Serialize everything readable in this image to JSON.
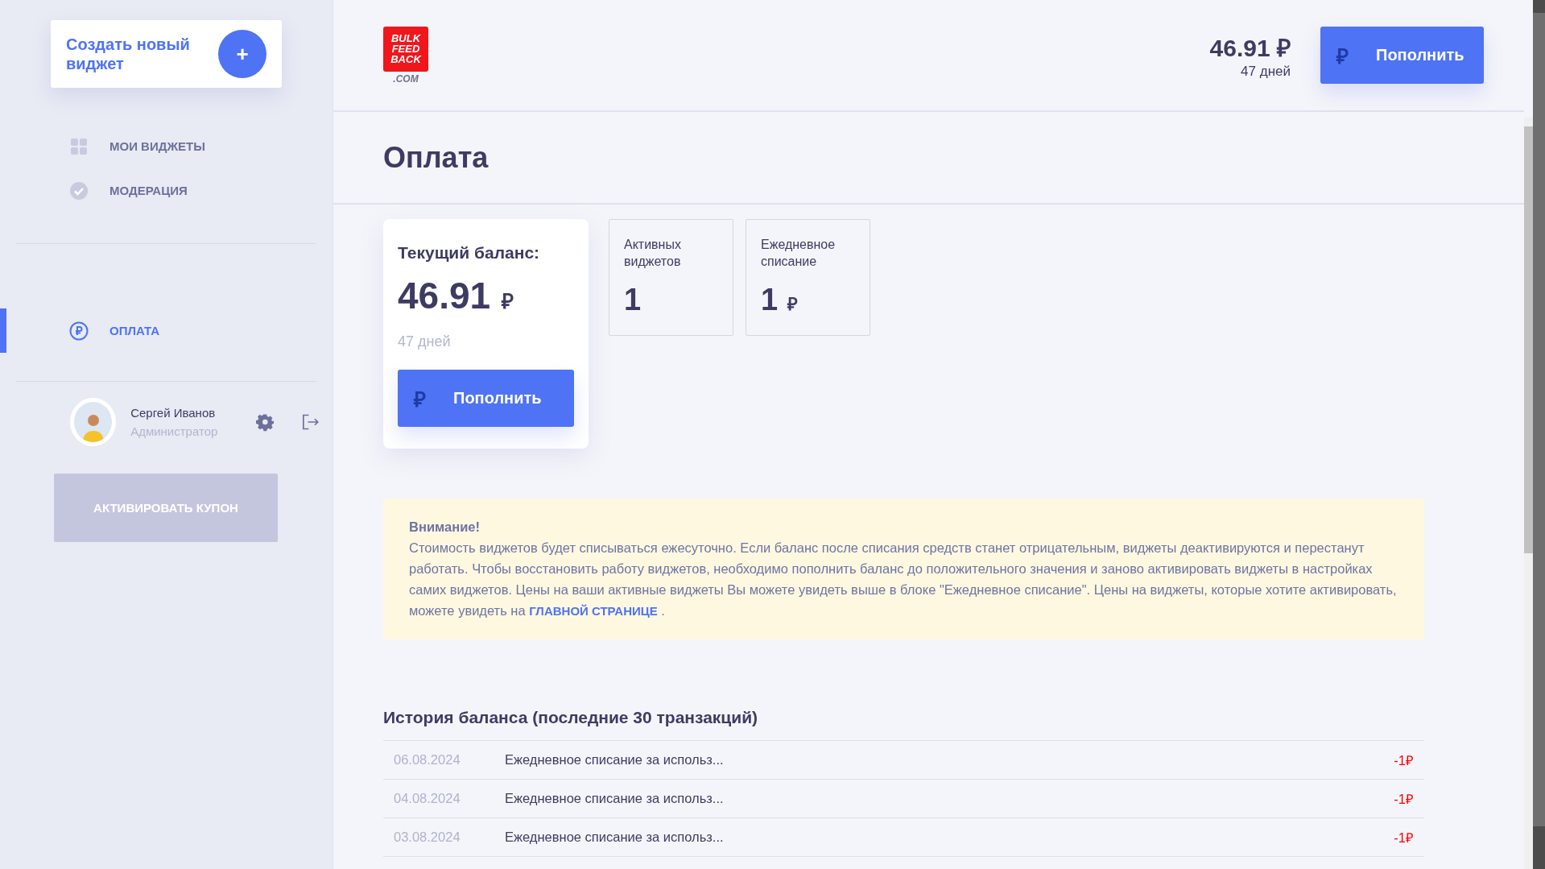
{
  "sidebar": {
    "create_widget": {
      "label": "Создать новый виджет",
      "button": "+"
    },
    "nav": [
      {
        "label": "МОИ ВИДЖЕТЫ",
        "selected": false
      },
      {
        "label": "МОДЕРАЦИЯ",
        "selected": false
      }
    ],
    "nav_secondary": [
      {
        "label": "ОПЛАТА",
        "selected": true
      }
    ],
    "user": {
      "name": "Сергей Иванов",
      "role": "Администратор"
    },
    "coupon_button": "АКТИВИРОВАТЬ КУПОН"
  },
  "header": {
    "logo": [
      "BULK",
      "FEED",
      "BACK"
    ],
    "logo_domain": ".COM",
    "balance": "46.91",
    "currency": "₽",
    "days": "47 дней",
    "button": {
      "icon": "₽",
      "label": "Пополнить"
    }
  },
  "page_title": "Оплата",
  "balance_card": {
    "title": "Текущий баланс:",
    "amount": "46.91",
    "currency": "₽",
    "days": "47 дней",
    "button": {
      "icon": "₽",
      "label": "Пополнить"
    }
  },
  "stat_cards": [
    {
      "label": "Активных виджетов",
      "value": "1"
    },
    {
      "label": "Ежедневное списание",
      "value": "1",
      "currency": "₽"
    }
  ],
  "notice": {
    "title": "Внимание!",
    "text": "Стоимость виджетов будет списываться ежесуточно. Если баланс после списания средств станет отрицательным, виджеты деактивируются и перестанут работать. Чтобы восстановить работу виджетов, необходимо пополнить баланс до положительного значения и заново активировать виджеты в настройках самих виджетов. Цены на ваши активные виджеты Вы можете увидеть выше в блоке \"Ежедневное списание\". Цены на виджеты, которые хотите активировать, можете увидеть на",
    "link": "ГЛАВНОЙ СТРАНИЦЕ",
    "text_after": "."
  },
  "history": {
    "title": "История баланса (последние 30 транзакций)",
    "rows": [
      {
        "date": "06.08.2024",
        "description": "Ежедневное списание за использ...",
        "amount": "-1₽"
      },
      {
        "date": "04.08.2024",
        "description": "Ежедневное списание за использ...",
        "amount": "-1₽"
      },
      {
        "date": "03.08.2024",
        "description": "Ежедневное списание за использ...",
        "amount": "-1₽"
      }
    ]
  }
}
